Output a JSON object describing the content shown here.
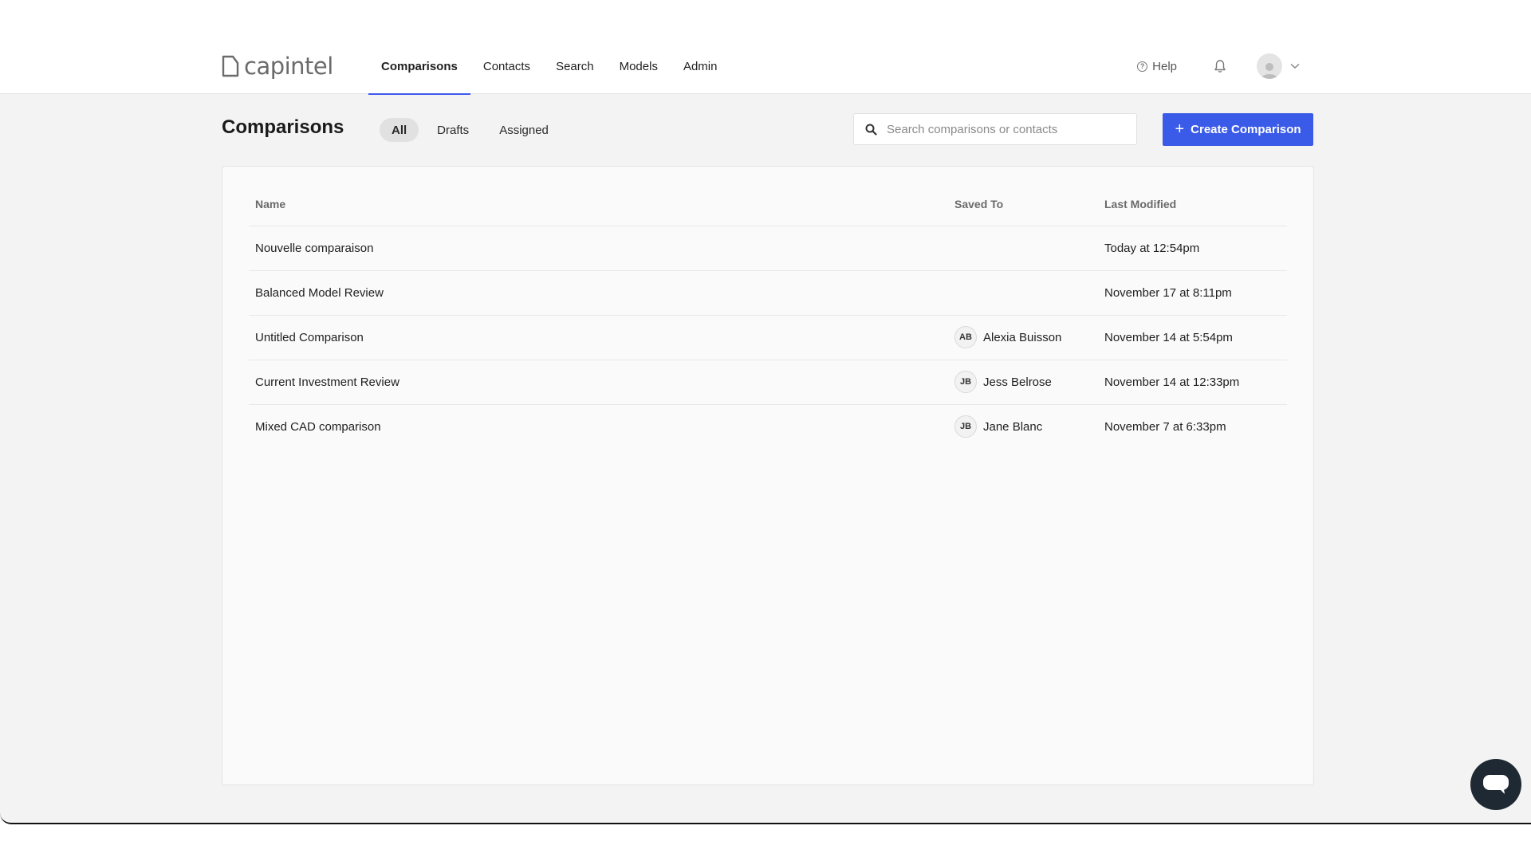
{
  "brand": {
    "name": "capintel"
  },
  "nav": {
    "items": [
      {
        "label": "Comparisons",
        "active": true
      },
      {
        "label": "Contacts"
      },
      {
        "label": "Search"
      },
      {
        "label": "Models"
      },
      {
        "label": "Admin"
      }
    ],
    "help_label": "Help"
  },
  "page": {
    "title": "Comparisons",
    "filters": [
      {
        "label": "All",
        "active": true
      },
      {
        "label": "Drafts"
      },
      {
        "label": "Assigned"
      }
    ],
    "search_placeholder": "Search comparisons or contacts",
    "create_label": "Create Comparison"
  },
  "table": {
    "headers": {
      "name": "Name",
      "saved_to": "Saved To",
      "last_modified": "Last Modified"
    },
    "rows": [
      {
        "name": "Nouvelle comparaison",
        "initials": "",
        "saved_to": "",
        "last_modified": "Today at 12:54pm"
      },
      {
        "name": "Balanced Model Review",
        "initials": "",
        "saved_to": "",
        "last_modified": "November 17 at 8:11pm"
      },
      {
        "name": "Untitled Comparison",
        "initials": "AB",
        "saved_to": "Alexia Buisson",
        "last_modified": "November 14 at 5:54pm"
      },
      {
        "name": "Current Investment Review",
        "initials": "JB",
        "saved_to": "Jess Belrose",
        "last_modified": "November 14 at 12:33pm"
      },
      {
        "name": "Mixed CAD comparison",
        "initials": "JB",
        "saved_to": "Jane Blanc",
        "last_modified": "November 7 at 6:33pm"
      }
    ]
  },
  "colors": {
    "accent": "#3a5ae8",
    "chat_fab": "#1f2933"
  },
  "icons": {
    "search": "search-icon",
    "help": "help-circle-icon",
    "bell": "bell-icon",
    "chevron": "chevron-down-icon",
    "chat": "chat-icon"
  }
}
